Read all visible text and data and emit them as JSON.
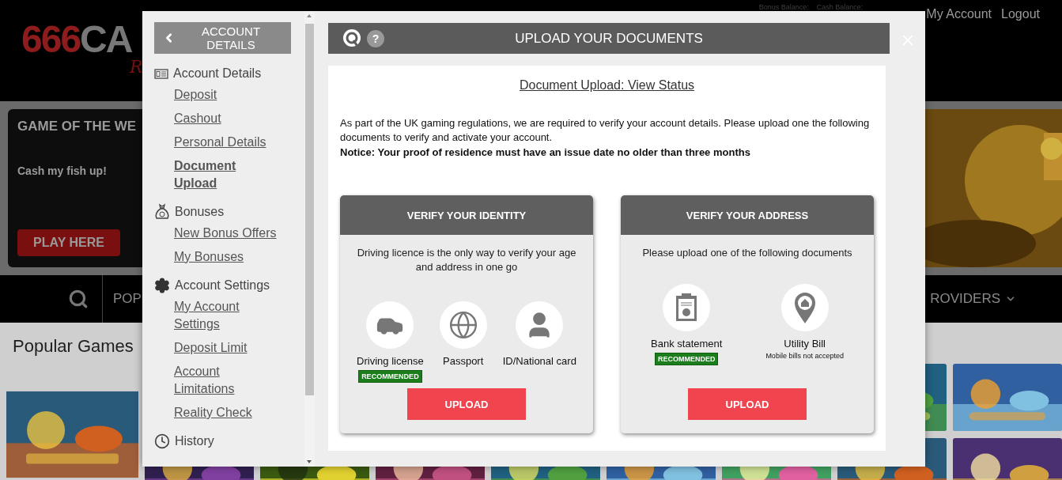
{
  "header": {
    "logo": {
      "number": "666",
      "word": "CA",
      "script": "R"
    },
    "balances": [
      "Bonus Balance:",
      "Cash Balance:"
    ],
    "links": [
      "My Account",
      "Logout"
    ]
  },
  "featured": {
    "title": "GAME OF THE WE",
    "tagline": "Cash my fish up!",
    "button": "PLAY HERE"
  },
  "nav": {
    "items": [
      {
        "label": "POP",
        "kind": "plain"
      },
      {
        "label": "ROVIDERS",
        "kind": "dropdown"
      }
    ]
  },
  "popular": {
    "title": "Popular Games"
  },
  "modal": {
    "back_button": "ACCOUNT DETAILS",
    "sidebar": {
      "sections": [
        {
          "title": "Account Details",
          "items": [
            {
              "label": "Deposit",
              "selected": false
            },
            {
              "label": "Cashout",
              "selected": false
            },
            {
              "label": "Personal Details",
              "selected": false
            },
            {
              "label": "Document Upload",
              "selected": true
            }
          ]
        },
        {
          "title": "Bonuses",
          "items": [
            {
              "label": "New Bonus Offers",
              "selected": false
            },
            {
              "label": "My Bonuses",
              "selected": false
            }
          ]
        },
        {
          "title": "Account Settings",
          "items": [
            {
              "label": "My Account Settings",
              "selected": false
            },
            {
              "label": "Deposit Limit",
              "selected": false
            },
            {
              "label": "Account Limitations",
              "selected": false
            },
            {
              "label": "Reality Check",
              "selected": false
            }
          ]
        },
        {
          "title": "History"
        }
      ]
    },
    "help_label": "?",
    "title": "UPLOAD YOUR DOCUMENTS",
    "status_link": "Document Upload: View Status",
    "intro": "As part of the UK gaming regulations, we are required to verify your account details. Please upload one the following documents to verify and activate your account.",
    "notice": "Notice: Your proof of residence must have an issue date no older than three months",
    "cards": [
      {
        "title": "VERIFY YOUR IDENTITY",
        "description": "Driving licence is the only way to verify your age and address in one go",
        "documents": [
          {
            "label": "Driving license",
            "badge": "RECOMMENDED"
          },
          {
            "label": "Passport"
          },
          {
            "label": "ID/National card"
          }
        ],
        "button": "UPLOAD"
      },
      {
        "title": "VERIFY YOUR ADDRESS",
        "description": "Please upload one of the following documents",
        "documents": [
          {
            "label": "Bank statement",
            "badge": "RECOMMENDED"
          },
          {
            "label": "Utility Bill",
            "note": "Mobile bills not accepted"
          }
        ],
        "button": "UPLOAD"
      }
    ]
  }
}
